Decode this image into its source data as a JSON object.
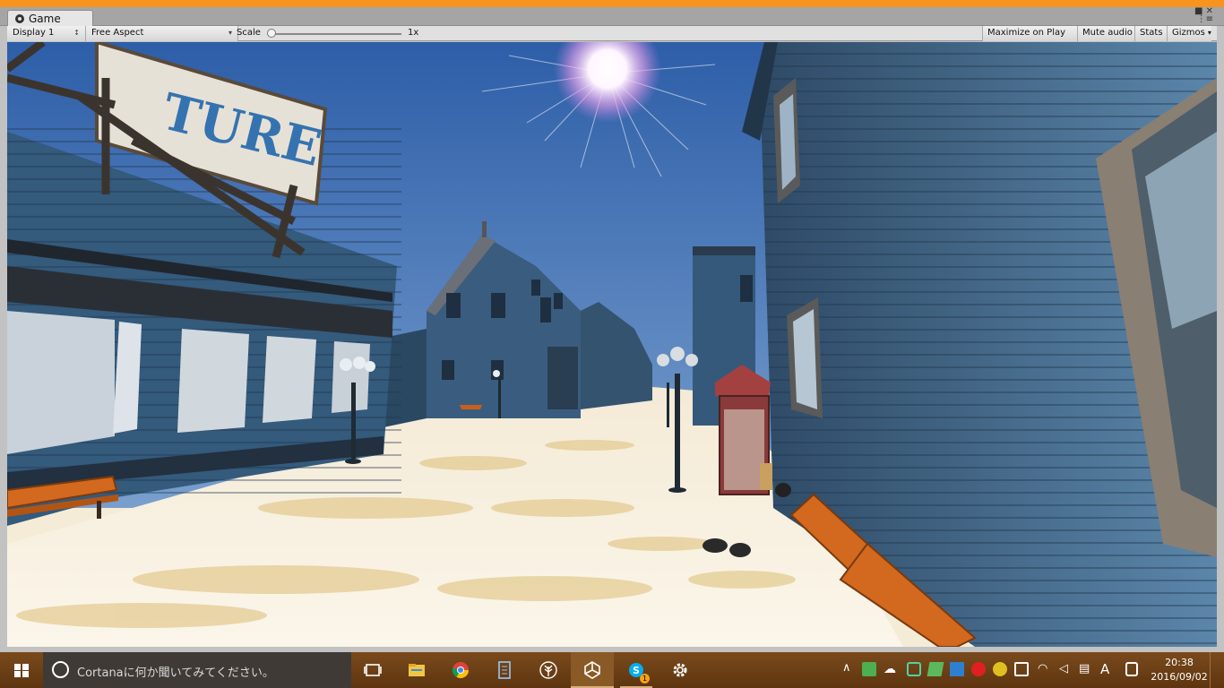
{
  "window": {
    "tab_title": "Game",
    "controls": "■ ✕"
  },
  "toolbar": {
    "display": "Display 1",
    "aspect": "Free Aspect",
    "scale_label": "Scale",
    "scale_value": "1x",
    "scale_level": 0.0,
    "maximize_on_play": "Maximize on Play",
    "mute_audio": "Mute audio",
    "stats": "Stats",
    "gizmos": "Gizmos"
  },
  "scene": {
    "sign_text": "TURE",
    "sky_color": "#3e6fb6",
    "wall_color": "#3f6687",
    "ground_color": "#f2e6cc",
    "bench_color": "#d2691e"
  },
  "taskbar": {
    "search_placeholder": "Cortanaに何か聞いてみてください。",
    "apps": [
      {
        "name": "task-view-icon"
      },
      {
        "name": "file-explorer-icon"
      },
      {
        "name": "chrome-icon"
      },
      {
        "name": "notes-icon"
      },
      {
        "name": "tree-app-icon"
      },
      {
        "name": "unity-icon"
      },
      {
        "name": "skype-icon",
        "badge": "1"
      },
      {
        "name": "settings-icon"
      }
    ],
    "tray": {
      "ime": "A"
    },
    "clock": {
      "time": "20:38",
      "date": "2016/09/02"
    },
    "accent_color": "#f7931e"
  }
}
